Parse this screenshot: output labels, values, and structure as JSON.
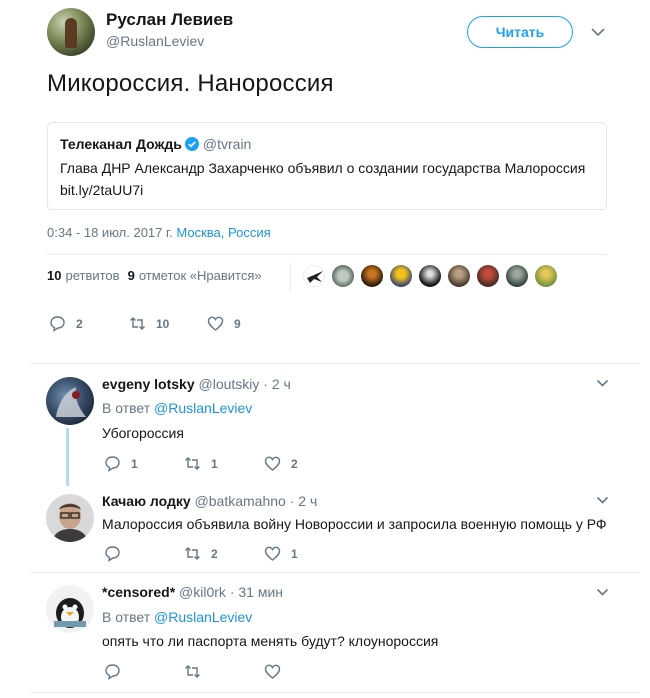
{
  "tweet": {
    "author_name": "Руслан Левиев",
    "author_handle": "@RuslanLeviev",
    "follow_label": "Читать",
    "text": "Микороссия. Нанороссия",
    "quote": {
      "name": "Телеканал Дождь",
      "handle": "@tvrain",
      "text": "Глава ДНР Александр Захарченко объявил о создании государства Малороссия",
      "link": "bit.ly/2taUU7i"
    },
    "timestamp": "0:34 - 18 июл. 2017 г.",
    "location": "Москва, Россия",
    "retweets_count": "10",
    "retweets_label": "ретвитов",
    "likes_count": "9",
    "likes_label": "отметок «Нравится»",
    "actions": {
      "replies": "2",
      "retweets": "10",
      "likes": "9"
    }
  },
  "replies": [
    {
      "name": "evgeny lotsky",
      "handle": "@loutskiy",
      "sep": "·",
      "time": "2 ч",
      "in_reply_prefix": "В ответ",
      "in_reply_to": "@RuslanLeviev",
      "text": "Убогороссия",
      "actions": {
        "replies": "1",
        "retweets": "1",
        "likes": "2"
      }
    },
    {
      "name": "Качаю лодку",
      "handle": "@batkamahno",
      "sep": "·",
      "time": "2 ч",
      "text": "Малороссия объявила войну Новороссии и запросила военную помощь у РФ",
      "actions": {
        "replies": "",
        "retweets": "2",
        "likes": "1"
      }
    },
    {
      "name": "*censored*",
      "handle": "@kil0rk",
      "sep": "·",
      "time": "31 мин",
      "in_reply_prefix": "В ответ",
      "in_reply_to": "@RuslanLeviev",
      "text": "опять что ли паспорта менять будут? клоунороссия"
    }
  ],
  "colors": {
    "accent": "#1da1f2",
    "link": "#1b95e0",
    "muted": "#657786",
    "thread_line": "#b3dbf7"
  }
}
